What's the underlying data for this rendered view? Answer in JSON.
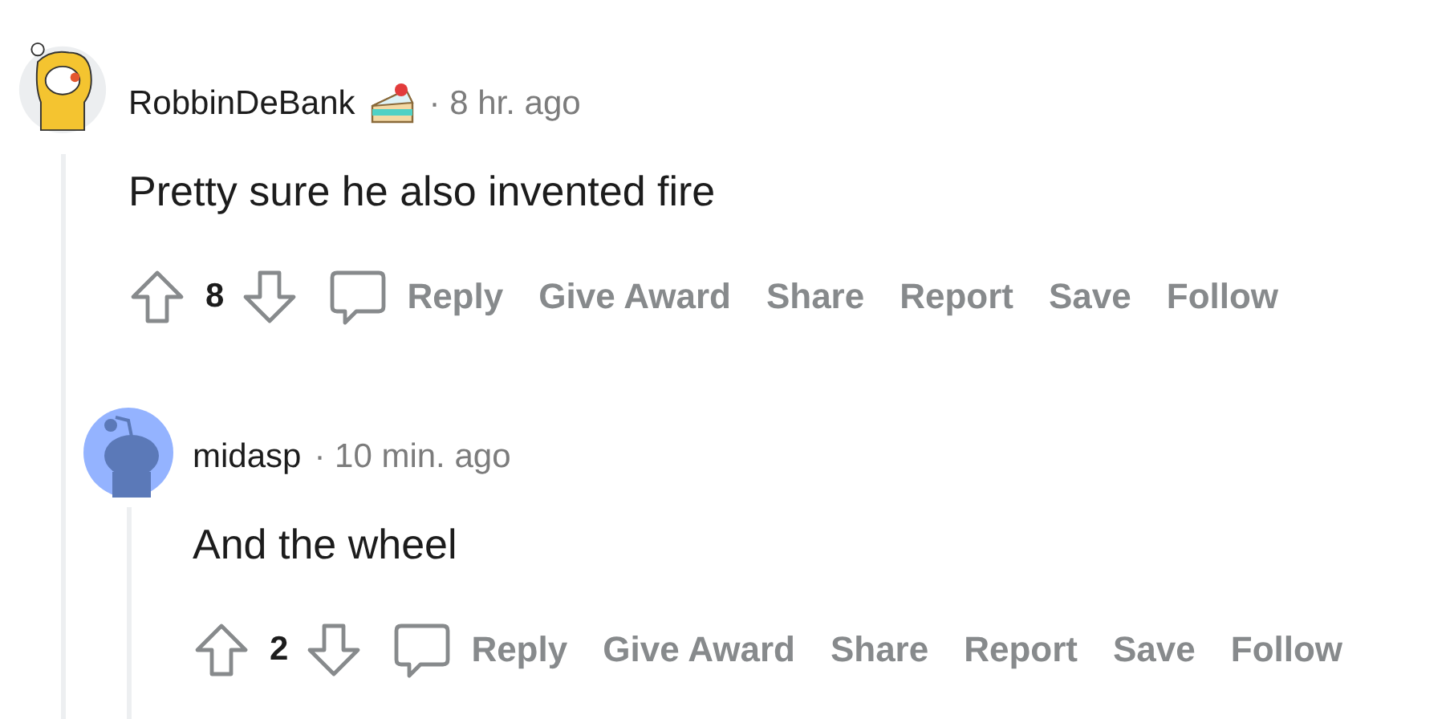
{
  "comments": [
    {
      "author": "RobbinDeBank",
      "flair": true,
      "time": "· 8 hr. ago",
      "body": "Pretty sure he also invented fire",
      "score": "8",
      "actions": [
        "Reply",
        "Give Award",
        "Share",
        "Report",
        "Save",
        "Follow"
      ],
      "children": [
        {
          "author": "midasp",
          "time": "· 10 min. ago",
          "body": "And the wheel",
          "score": "2",
          "actions": [
            "Reply",
            "Give Award",
            "Share",
            "Report",
            "Save",
            "Follow"
          ]
        }
      ]
    }
  ]
}
